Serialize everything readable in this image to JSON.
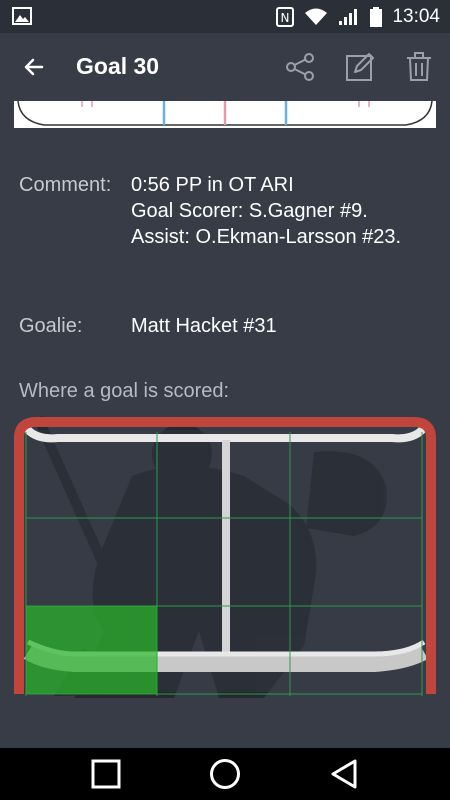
{
  "status_bar": {
    "time": "13:04",
    "icons": [
      "gallery-icon",
      "nfc-icon",
      "wifi-icon",
      "signal-icon",
      "battery-icon"
    ]
  },
  "app_bar": {
    "title": "Goal 30",
    "back_icon": "arrow-left-icon",
    "actions": [
      "share-icon",
      "edit-icon",
      "delete-icon"
    ]
  },
  "details": {
    "comment_label": "Comment:",
    "comment_lines": [
      "0:56 PP in OT ARI",
      "Goal Scorer: S.Gagner #9.",
      "Assist: O.Ekman-Larsson #23."
    ],
    "goalie_label": "Goalie:",
    "goalie_value": "Matt Hacket #31"
  },
  "goal_section": {
    "title": "Where a goal is scored:",
    "grid_rows": 3,
    "grid_cols": 3,
    "scored_zone": "bottom-left"
  },
  "colors": {
    "background": "#373c47",
    "status_bar": "#2b2f38",
    "goal_post": "#c0453d",
    "scored_zone": "#2ab42a",
    "grid_line": "#2f9a4a"
  },
  "nav_bar": {
    "buttons": [
      "recents-icon",
      "home-icon",
      "back-icon"
    ]
  }
}
